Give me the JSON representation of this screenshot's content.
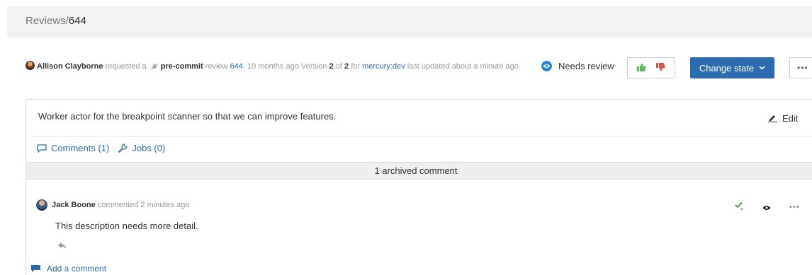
{
  "breadcrumb": {
    "section": "Reviews/",
    "id": "644"
  },
  "review": {
    "author": "Allison Clayborne",
    "requested_text": " requested a ",
    "review_type": "pre-commit",
    "review_word": " review ",
    "review_id": "644",
    "age_text": ", 10 months ago Version ",
    "version": "2",
    "of_text": " of ",
    "version_total": "2",
    "for_text": " for ",
    "branch": "mercury:dev",
    "updated_text": " last updated about a minute ago."
  },
  "status": {
    "label": "Needs review",
    "color": "#2f86c9"
  },
  "actions": {
    "change_state_label": "Change state",
    "more_label": "•••"
  },
  "description": {
    "text": "Worker actor for the breakpoint scanner so that we can improve features.",
    "edit_label": "Edit"
  },
  "tabs": [
    {
      "label": "Comments (1)",
      "icon": "comment-icon"
    },
    {
      "label": "Jobs (0)",
      "icon": "wrench-icon"
    }
  ],
  "archived": {
    "label": "1 archived comment"
  },
  "comment": {
    "author": "Jack Boone",
    "meta": " commented 2 minutes ago",
    "body": "This description needs more detail.",
    "more_label": "•••"
  },
  "add_comment": {
    "label": "Add a comment"
  },
  "colors": {
    "accent": "#2b6cb0",
    "thumbs_up": "#5cb85c",
    "thumbs_down": "#d9534f",
    "check": "#3a9a3a"
  }
}
